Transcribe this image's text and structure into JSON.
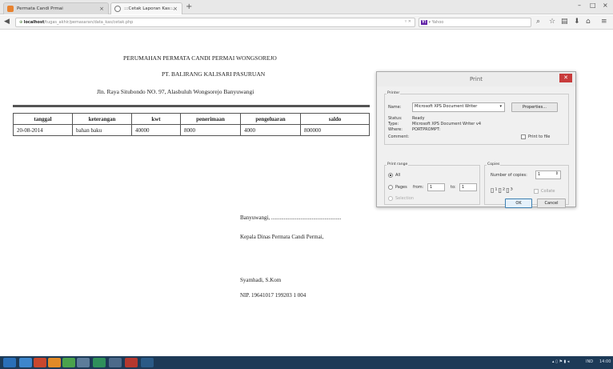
{
  "browser": {
    "tabs": [
      {
        "label": "Permata Candi Prmai",
        "close": "×"
      },
      {
        "label": ":::Cetak Laporan Kas::.",
        "close": "×"
      }
    ],
    "new_tab": "+",
    "url_host": "localhost",
    "url_path": "/tugas_akhir/pemasaran/data_kas/cetak.php",
    "search_placeholder": "Yahoo",
    "window_controls": [
      "–",
      "□",
      "×"
    ]
  },
  "report": {
    "header_line1": "PERUMAHAN PERMATA CANDI PERMAI WONGSOREJO",
    "header_line2": "PT. BALIRANG KALISARI PASURUAN",
    "header_line3": "Jln. Raya Situbondo NO. 97, Alasbuluh Wongsorejo Banyuwangi",
    "columns": [
      "tanggal",
      "keterangan",
      "kwt",
      "penerimaan",
      "pengeluaran",
      "saldo"
    ],
    "rows": [
      [
        "20-08-2014",
        "bahan baku",
        "40000",
        "8000",
        "4000",
        "800000"
      ]
    ],
    "place_date": "Banyuwangi, ..................................................",
    "sign_title": "Kepala Dinas Permata Candi Permai,",
    "signer_name": "Syamhadi, S.Kom",
    "signer_nip": "NIP. 19641017 199203 1 004"
  },
  "print_dialog": {
    "title": "Print",
    "printer_group": "Printer",
    "name_label": "Name:",
    "printer_name": "Microsoft XPS Document Writer",
    "properties_button": "Properties...",
    "status_label": "Status:",
    "status_value": "Ready",
    "type_label": "Type:",
    "type_value": "Microsoft XPS Document Writer v4",
    "where_label": "Where:",
    "where_value": "PORTPROMPT:",
    "comment_label": "Comment:",
    "print_to_file": "Print to file",
    "range_group": "Print range",
    "range_all": "All",
    "range_pages": "Pages",
    "from_label": "from:",
    "from_value": "1",
    "to_label": "to:",
    "to_value": "1",
    "range_selection": "Selection",
    "copies_group": "Copies",
    "copies_label": "Number of copies:",
    "copies_value": "1",
    "collate_label": "Collate",
    "ok_button": "OK",
    "cancel_button": "Cancel"
  },
  "taskbar": {
    "lang": "IND",
    "time": "14:00"
  }
}
